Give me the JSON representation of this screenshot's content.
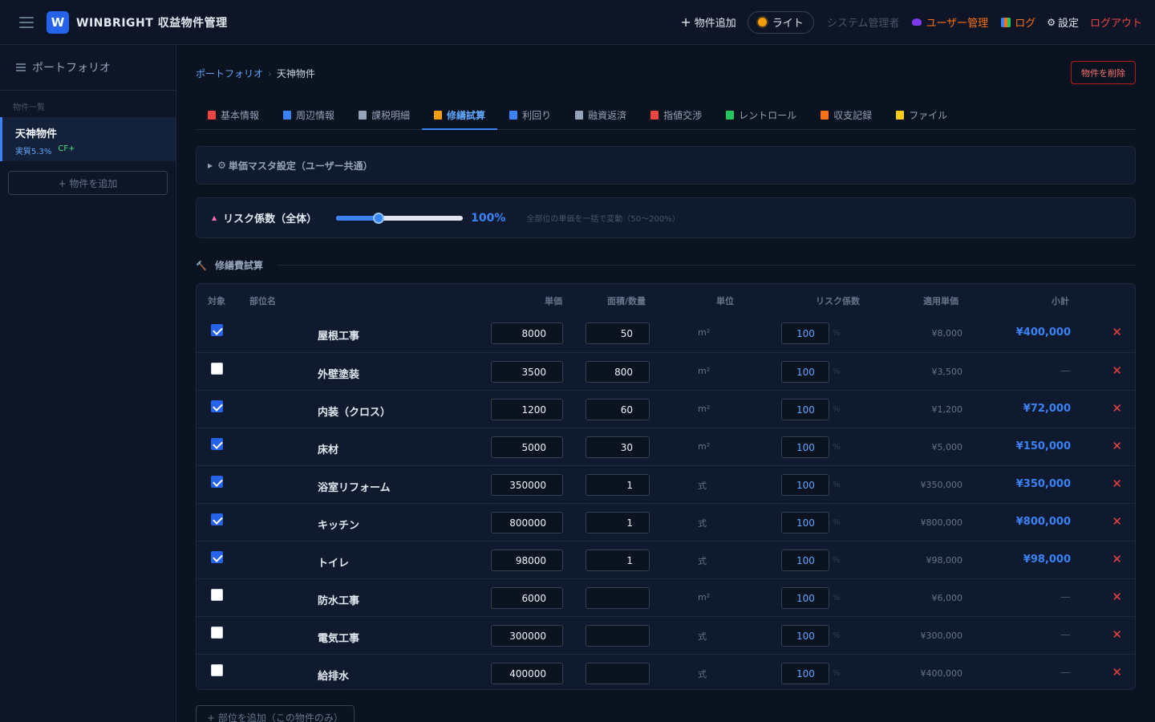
{
  "app": {
    "logo_letter": "W",
    "title": "WINBRIGHT 収益物件管理"
  },
  "topnav": {
    "add_property": "物件追加",
    "theme": "ライト",
    "role": "システム管理者",
    "users": "ユーザー管理",
    "log": "ログ",
    "settings": "設定",
    "logout": "ログアウト"
  },
  "sidebar": {
    "portfolio": "ポートフォリオ",
    "section_label": "物件一覧",
    "property": {
      "name": "天神物件",
      "yield": "実質5.3%",
      "cf": "CF+"
    },
    "add_button": "+ 物件を追加"
  },
  "breadcrumb": {
    "parent": "ポートフォリオ",
    "separator": "›",
    "current": "天神物件"
  },
  "delete_button": "物件を削除",
  "tabs": [
    {
      "label": "基本情報",
      "icon": "clipboard-icon",
      "color": "#ef4444"
    },
    {
      "label": "周辺情報",
      "icon": "map-icon",
      "color": "#3b82f6"
    },
    {
      "label": "課税明細",
      "icon": "document-icon",
      "color": "#94a3b8"
    },
    {
      "label": "修繕試算",
      "icon": "hammer-icon",
      "color": "#f59e0b"
    },
    {
      "label": "利回り",
      "icon": "chart-icon",
      "color": "#3b82f6"
    },
    {
      "label": "融資返済",
      "icon": "bank-icon",
      "color": "#94a3b8"
    },
    {
      "label": "指値交渉",
      "icon": "target-icon",
      "color": "#ef4444"
    },
    {
      "label": "レントロール",
      "icon": "house-icon",
      "color": "#22c55e"
    },
    {
      "label": "収支記録",
      "icon": "ledger-icon",
      "color": "#f97316"
    },
    {
      "label": "ファイル",
      "icon": "folder-icon",
      "color": "#facc15"
    }
  ],
  "active_tab": 3,
  "master_settings": "単価マスタ設定（ユーザー共通）",
  "risk": {
    "label": "リスク係数（全体）",
    "value_percent": 100,
    "value_label": "100%",
    "slider_min": 50,
    "slider_max": 200,
    "description": "全部位の単価を一括で変動（50〜200%）"
  },
  "section_title": "修繕費試算",
  "table": {
    "headers": {
      "target": "対象",
      "part": "部位名",
      "price": "単価",
      "qty": "面積/数量",
      "unit": "単位",
      "risk": "リスク係数",
      "applied": "適用単価",
      "subtotal": "小計"
    },
    "pct_suffix": "%",
    "delete_symbol": "✕",
    "rows": [
      {
        "checked": true,
        "name": "屋根工事",
        "price": "8000",
        "qty": "50",
        "unit": "m²",
        "risk": "100",
        "applied": "¥8,000",
        "subtotal": "¥400,000"
      },
      {
        "checked": false,
        "name": "外壁塗装",
        "price": "3500",
        "qty": "800",
        "unit": "m²",
        "risk": "100",
        "applied": "¥3,500",
        "subtotal": "—"
      },
      {
        "checked": true,
        "name": "内装（クロス）",
        "price": "1200",
        "qty": "60",
        "unit": "m²",
        "risk": "100",
        "applied": "¥1,200",
        "subtotal": "¥72,000"
      },
      {
        "checked": true,
        "name": "床材",
        "price": "5000",
        "qty": "30",
        "unit": "m²",
        "risk": "100",
        "applied": "¥5,000",
        "subtotal": "¥150,000"
      },
      {
        "checked": true,
        "name": "浴室リフォーム",
        "price": "350000",
        "qty": "1",
        "unit": "式",
        "risk": "100",
        "applied": "¥350,000",
        "subtotal": "¥350,000"
      },
      {
        "checked": true,
        "name": "キッチン",
        "price": "800000",
        "qty": "1",
        "unit": "式",
        "risk": "100",
        "applied": "¥800,000",
        "subtotal": "¥800,000"
      },
      {
        "checked": true,
        "name": "トイレ",
        "price": "98000",
        "qty": "1",
        "unit": "式",
        "risk": "100",
        "applied": "¥98,000",
        "subtotal": "¥98,000"
      },
      {
        "checked": false,
        "name": "防水工事",
        "price": "6000",
        "qty": "",
        "unit": "m²",
        "risk": "100",
        "applied": "¥6,000",
        "subtotal": "—"
      },
      {
        "checked": false,
        "name": "電気工事",
        "price": "300000",
        "qty": "",
        "unit": "式",
        "risk": "100",
        "applied": "¥300,000",
        "subtotal": "—"
      },
      {
        "checked": false,
        "name": "給排水",
        "price": "400000",
        "qty": "",
        "unit": "式",
        "risk": "100",
        "applied": "¥400,000",
        "subtotal": "—"
      }
    ]
  },
  "add_part_button": "+ 部位を追加（この物件のみ）",
  "colors": {
    "accent": "#3b82f6",
    "danger": "#ef4444",
    "warning": "#f97316",
    "success": "#4ade80",
    "background": "#0b1220",
    "panel": "#0f1a2e"
  }
}
